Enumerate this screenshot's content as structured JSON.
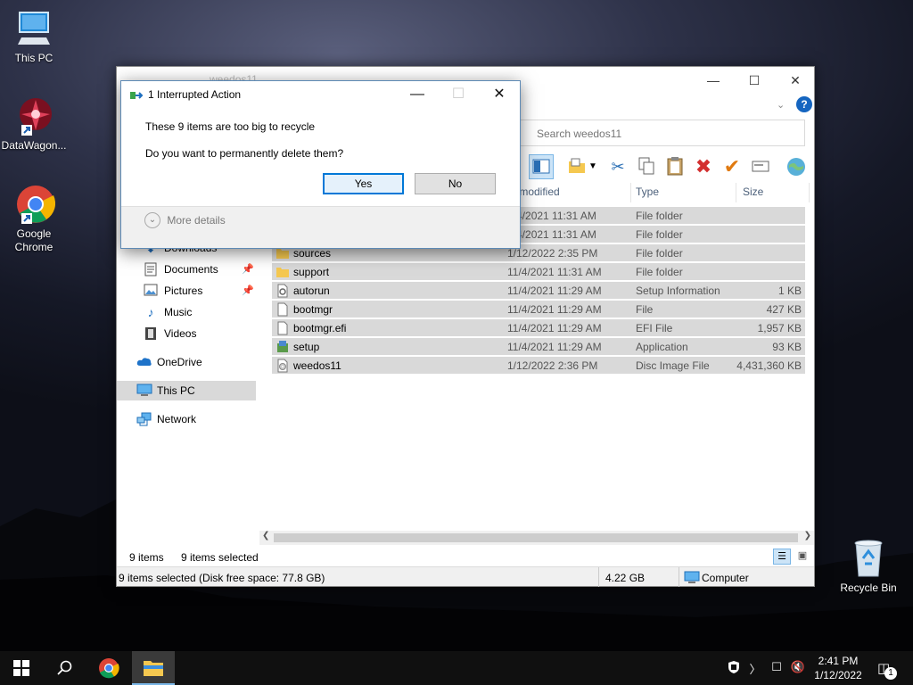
{
  "desktop": {
    "icons": [
      {
        "label": "This PC",
        "icon": "monitor-icon"
      },
      {
        "label": "DataWagon...",
        "icon": "datawagon-icon"
      },
      {
        "label": "Google Chrome",
        "icon": "chrome-icon"
      },
      {
        "label": "Recycle Bin",
        "icon": "recycle-bin-icon"
      }
    ]
  },
  "explorer": {
    "title": "weedos11",
    "search_placeholder": "Search weedos11",
    "columns": {
      "date": "te modified",
      "type": "Type",
      "size": "Size"
    },
    "nav": [
      {
        "label": "Downloads",
        "icon": "download-icon"
      },
      {
        "label": "Documents",
        "icon": "documents-icon",
        "pinned": true
      },
      {
        "label": "Pictures",
        "icon": "pictures-icon",
        "pinned": true
      },
      {
        "label": "Music",
        "icon": "music-icon"
      },
      {
        "label": "Videos",
        "icon": "videos-icon"
      },
      {
        "label": "OneDrive",
        "icon": "onedrive-icon"
      },
      {
        "label": "This PC",
        "icon": "monitor-icon",
        "selected": true
      },
      {
        "label": "Network",
        "icon": "network-icon"
      }
    ],
    "files": [
      {
        "name": "",
        "date": "1/4/2021 11:31 AM",
        "type": "File folder",
        "size": "",
        "icon": "folder-icon"
      },
      {
        "name": "",
        "date": "1/4/2021 11:31 AM",
        "type": "File folder",
        "size": "",
        "icon": "folder-icon"
      },
      {
        "name": "sources",
        "date": "1/12/2022 2:35 PM",
        "type": "File folder",
        "size": "",
        "icon": "folder-icon"
      },
      {
        "name": "support",
        "date": "11/4/2021 11:31 AM",
        "type": "File folder",
        "size": "",
        "icon": "folder-icon"
      },
      {
        "name": "autorun",
        "date": "11/4/2021 11:29 AM",
        "type": "Setup Information",
        "size": "1 KB",
        "icon": "settings-file-icon"
      },
      {
        "name": "bootmgr",
        "date": "11/4/2021 11:29 AM",
        "type": "File",
        "size": "427 KB",
        "icon": "file-icon"
      },
      {
        "name": "bootmgr.efi",
        "date": "11/4/2021 11:29 AM",
        "type": "EFI File",
        "size": "1,957 KB",
        "icon": "file-icon"
      },
      {
        "name": "setup",
        "date": "11/4/2021 11:29 AM",
        "type": "Application",
        "size": "93 KB",
        "icon": "setup-icon"
      },
      {
        "name": "weedos11",
        "date": "1/12/2022 2:36 PM",
        "type": "Disc Image File",
        "size": "4,431,360 KB",
        "icon": "disc-image-icon"
      }
    ],
    "status": {
      "item_count": "9 items",
      "selected_count": "9 items selected",
      "detail": "9 items selected (Disk free space: 77.8 GB)",
      "total_size": "4.22 GB",
      "location": "Computer"
    }
  },
  "dialog": {
    "title": "1 Interrupted Action",
    "message": "These 9 items are too big to recycle",
    "question": "Do you want to permanently delete them?",
    "yes_label": "Yes",
    "no_label": "No",
    "more_details_label": "More details"
  },
  "taskbar": {
    "time": "2:41 PM",
    "date": "1/12/2022",
    "notification_count": "1"
  }
}
